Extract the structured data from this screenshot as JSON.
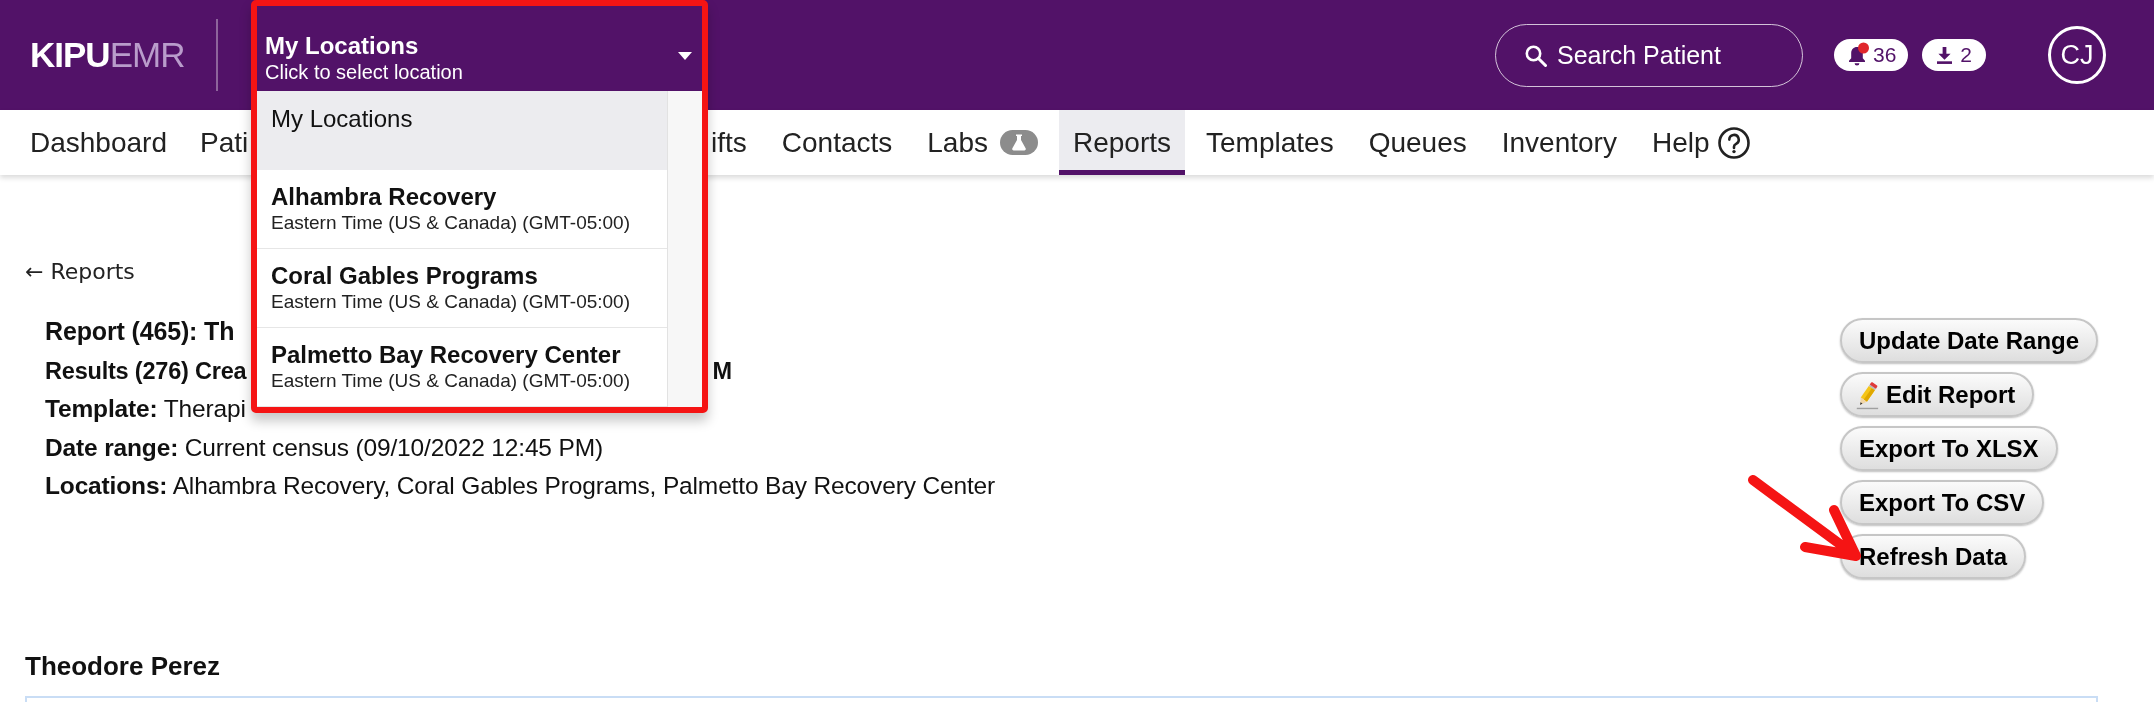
{
  "header": {
    "logo": {
      "bold": "KIPU",
      "light": "EMR"
    },
    "location_select": {
      "title": "My Locations",
      "hint": "Click to select location",
      "expanded": true,
      "options": [
        {
          "name": "My Locations",
          "selected": true
        },
        {
          "name": "Alhambra Recovery",
          "timezone": "Eastern Time (US & Canada) (GMT-05:00)",
          "selected": false
        },
        {
          "name": "Coral Gables Programs",
          "timezone": "Eastern Time (US & Canada) (GMT-05:00)",
          "selected": false
        },
        {
          "name": "Palmetto Bay Recovery Center",
          "timezone": "Eastern Time (US & Canada) (GMT-05:00)",
          "selected": false
        }
      ]
    },
    "search": {
      "placeholder": "Search Patient"
    },
    "notifications": {
      "count": "36"
    },
    "downloads": {
      "count": "2"
    },
    "user": {
      "initials": "CJ"
    }
  },
  "nav": {
    "left": [
      {
        "label": "Dashboard",
        "kind": "plain",
        "selected": false
      },
      {
        "label": "Pati",
        "kind": "plain",
        "selected": false
      }
    ],
    "right": [
      {
        "label": "ifts",
        "kind": "plain",
        "selected": false
      },
      {
        "label": "Contacts",
        "kind": "plain",
        "selected": false
      },
      {
        "label": "Labs",
        "kind": "badge",
        "selected": false
      },
      {
        "label": "Reports",
        "kind": "plain",
        "selected": true
      },
      {
        "label": "Templates",
        "kind": "plain",
        "selected": false
      },
      {
        "label": "Queues",
        "kind": "plain",
        "selected": false
      },
      {
        "label": "Inventory",
        "kind": "plain",
        "selected": false
      },
      {
        "label": "Help",
        "kind": "help",
        "selected": false
      }
    ]
  },
  "report": {
    "back_link": "← Reports",
    "title": "Report (465): Th",
    "results": {
      "left": "Results (276) Crea",
      "right": "M"
    },
    "details": [
      "**Template:** Therapi",
      "**Date range:** Current census (09/10/2022 12:45 PM)",
      "**Locations:** Alhambra Recovery, Coral Gables Programs, Palmetto Bay Recovery Center"
    ],
    "actions": [
      {
        "label": "Update Date Range",
        "kind": "plain"
      },
      {
        "label": "Edit Report",
        "kind": "icon"
      },
      {
        "label": "Export To XLSX",
        "kind": "plain"
      },
      {
        "label": "Export To CSV",
        "kind": "plain"
      },
      {
        "label": "Refresh Data",
        "kind": "plain"
      }
    ]
  },
  "patient": {
    "name": "Theodore Perez"
  }
}
